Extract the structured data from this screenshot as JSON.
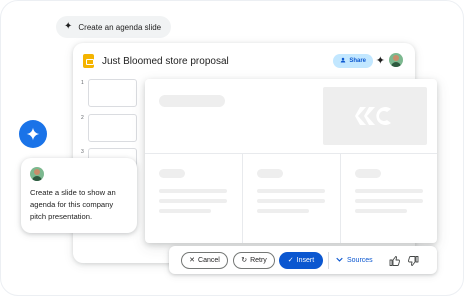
{
  "prompt_chip": {
    "icon": "sparkle-icon",
    "label": "Create an agenda slide"
  },
  "app": {
    "doc_icon": "slides-doc-icon",
    "title": "Just Bloomed store proposal",
    "share_label": "Share",
    "share_icon": "person-icon",
    "gemini_icon": "sparkle-icon",
    "avatar": "user-avatar",
    "thumbnails": [
      {
        "number": "1"
      },
      {
        "number": "2"
      },
      {
        "number": "3"
      }
    ]
  },
  "user_message": {
    "avatar": "user-avatar",
    "text": "Create a slide to show an agenda for this company pitch presentation."
  },
  "actions": {
    "cancel_label": "Cancel",
    "cancel_icon": "close-icon",
    "retry_label": "Retry",
    "retry_icon": "refresh-icon",
    "insert_label": "Insert",
    "insert_icon": "check-icon",
    "sources_label": "Sources",
    "sources_icon": "chevron-down-icon",
    "thumbs_up_icon": "thumbs-up-icon",
    "thumbs_down_icon": "thumbs-down-icon"
  },
  "colors": {
    "accent": "#0b57d0",
    "gemini_blue": "#1a73e8",
    "share_bg": "#c2e7ff",
    "doc_yellow": "#f4b400",
    "placeholder_gray": "#eeeeee"
  }
}
